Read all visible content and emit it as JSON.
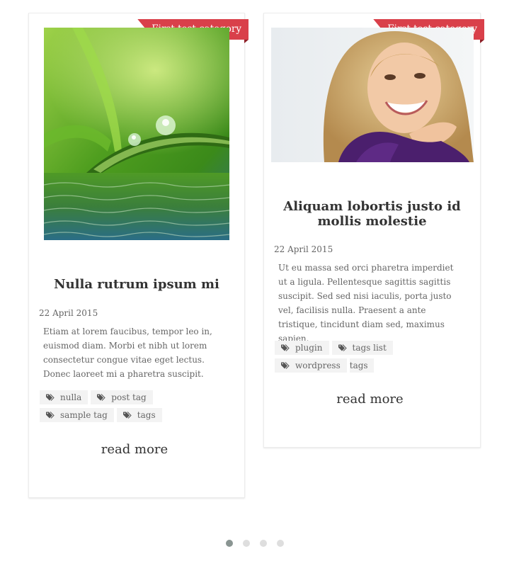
{
  "posts": [
    {
      "category": "First test category",
      "image": "water-drops-on-grass-photo",
      "title": "Nulla rutrum ipsum mi",
      "date": "22 April 2015",
      "excerpt": "Etiam at lorem faucibus, tempor leo in, euismod diam. Morbi et nibh ut lorem consectetur congue vitae eget lectus. Donec laoreet mi a pharetra suscipit.",
      "tags": [
        "nulla",
        "post tag",
        "sample tag",
        "tags"
      ],
      "read_more": "read more"
    },
    {
      "category": "First test category",
      "image": "smiling-woman-photo",
      "title": "Aliquam lobortis justo id mollis molestie",
      "date": "22 April 2015",
      "excerpt": "Ut eu massa sed orci pharetra imperdiet ut a ligula. Pellentesque sagittis sagittis suscipit. Sed sed nisi iaculis, porta justo vel, facilisis nulla. Praesent a ante tristique, tincidunt diam sed, maximus sapien.",
      "tags": [
        "plugin",
        "tags list",
        "wordpress",
        "tags"
      ],
      "read_more": "read more"
    }
  ],
  "pagination": {
    "pages": 4,
    "active": 1
  },
  "colors": {
    "ribbon": "#d9404a",
    "dot_active": "#8a9592",
    "dot_inactive": "#dedede"
  },
  "icons": {
    "tag": "tag-icon"
  }
}
